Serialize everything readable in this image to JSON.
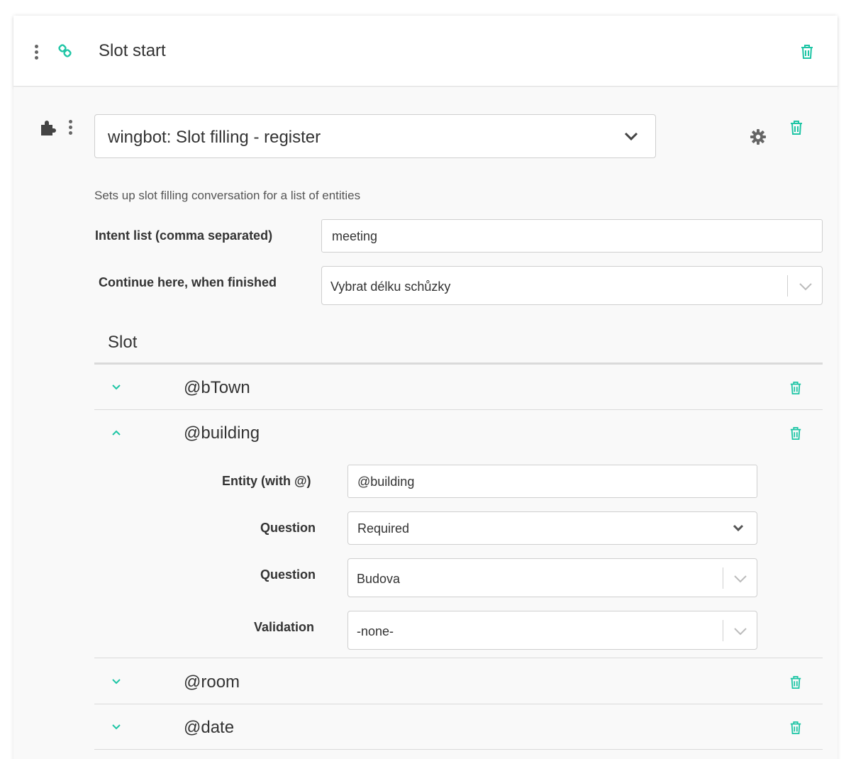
{
  "header": {
    "title": "Slot start",
    "menu_icon": "vertical-dots-icon",
    "link_icon": "link-icon",
    "delete_icon": "trash-icon"
  },
  "plugin": {
    "plugin_icon": "puzzle-icon",
    "selected": "wingbot: Slot filling - register",
    "settings_icon": "gear-icon",
    "delete_icon": "trash-icon",
    "description": "Sets up slot filling conversation for a list of entities"
  },
  "form": {
    "intent_label": "Intent list (comma separated)",
    "intent_value": "meeting",
    "continue_label": "Continue here, when finished",
    "continue_value": "Vybrat délku schůzky"
  },
  "slots": {
    "heading": "Slot",
    "items": [
      {
        "name": "@bTown",
        "expanded": false
      },
      {
        "name": "@building",
        "expanded": true
      },
      {
        "name": "@room",
        "expanded": false
      },
      {
        "name": "@date",
        "expanded": false
      }
    ],
    "detail": {
      "entity_label": "Entity (with @)",
      "entity_value": "@building",
      "question_label_1": "Question",
      "question_value_1": "Required",
      "question_label_2": "Question",
      "question_value_2": "Budova",
      "validation_label": "Validation",
      "validation_value": "-none-"
    }
  },
  "colors": {
    "accent": "#1ec5a5",
    "text": "#333333",
    "border": "#cfcfcf"
  }
}
